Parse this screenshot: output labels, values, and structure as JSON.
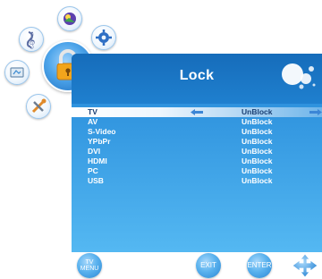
{
  "menu": {
    "title": "Lock",
    "icons": [
      "picture-icon",
      "sound-icon",
      "settings-icon",
      "channel-icon",
      "lock-icon",
      "screen-icon",
      "tools-icon"
    ],
    "active": "lock-icon"
  },
  "rows": [
    {
      "label": "TV",
      "value": "UnBlock",
      "selected": true
    },
    {
      "label": "AV",
      "value": "UnBlock"
    },
    {
      "label": "S-Video",
      "value": "UnBlock"
    },
    {
      "label": "YPbPr",
      "value": "UnBlock"
    },
    {
      "label": "DVI",
      "value": "UnBlock"
    },
    {
      "label": "HDMI",
      "value": "UnBlock"
    },
    {
      "label": "PC",
      "value": "UnBlock"
    },
    {
      "label": "USB",
      "value": "UnBlock"
    }
  ],
  "footer": {
    "tv_menu_top": "TV",
    "tv_menu_bottom": "MENU",
    "exit": "EXIT",
    "enter": "ENTER",
    "nav_icon": "dpad-icon"
  },
  "colors": {
    "header": "#166cba",
    "panel_bottom": "#54b8f2",
    "highlight": "#ffffff",
    "lock_accent": "#f2a51c"
  }
}
